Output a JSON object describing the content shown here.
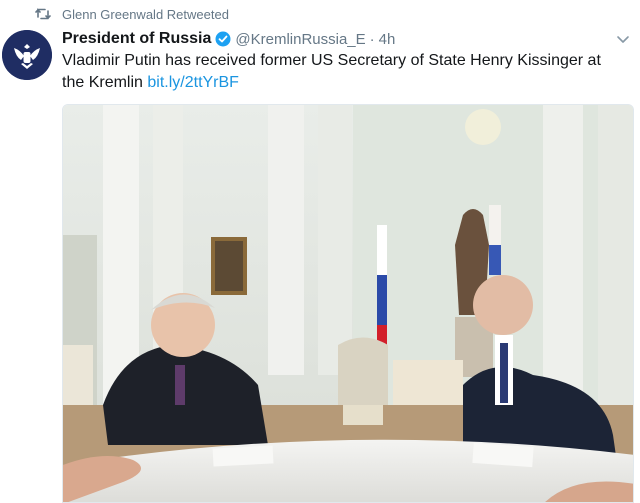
{
  "retweet": {
    "icon": "retweet-icon",
    "text": "Glenn Greenwald Retweeted"
  },
  "tweet": {
    "author_name": "President of Russia",
    "verified": true,
    "handle": "@KremlinRussia_E",
    "separator": "·",
    "time": "4h",
    "text": "Vladimir Putin has received former US Secretary of State Henry Kissinger at the Kremlin",
    "link": "bit.ly/2ttYrBF",
    "colors": {
      "link": "#1b95e0",
      "secondary": "#657786",
      "verified": "#1da1f2"
    }
  },
  "icons": {
    "avatar": "coat-of-arms-icon",
    "verified": "verified-badge-icon",
    "menu": "chevron-down-icon"
  }
}
